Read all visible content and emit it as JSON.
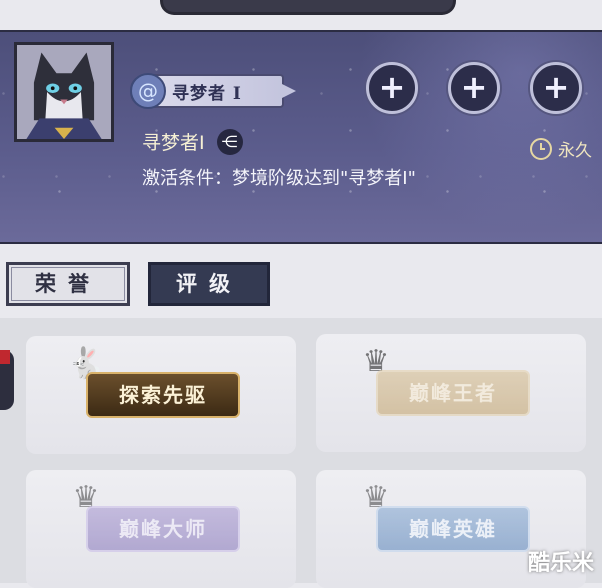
{
  "title_card": {
    "badge_text": "寻梦者 I",
    "name": "寻梦者I",
    "condition": "激活条件：梦境阶级达到\"寻梦者I\"",
    "duration": "永久",
    "slot_symbol": "+"
  },
  "tabs": {
    "honor": "荣誉",
    "rank": "评级"
  },
  "titles": [
    {
      "label": "探索先驱",
      "state": "unlocked"
    },
    {
      "label": "巅峰王者",
      "state": "locked"
    },
    {
      "label": "巅峰大师",
      "state": "locked"
    },
    {
      "label": "巅峰英雄",
      "state": "locked"
    }
  ],
  "watermark": "酷乐米",
  "colors": {
    "card_bg": "#5b5c8c",
    "gold_text": "#f6f0d4",
    "dark_tab": "#343a52"
  }
}
